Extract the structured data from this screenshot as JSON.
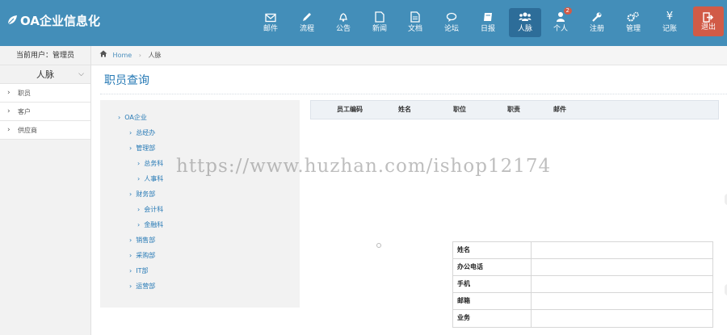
{
  "brand": {
    "title": "OA企业信息化"
  },
  "nav": [
    {
      "label": "邮件",
      "icon": "mail-icon"
    },
    {
      "label": "流程",
      "icon": "pencil-icon"
    },
    {
      "label": "公告",
      "icon": "bell-icon"
    },
    {
      "label": "新闻",
      "icon": "document-icon"
    },
    {
      "label": "文档",
      "icon": "file-icon"
    },
    {
      "label": "论坛",
      "icon": "chat-icon"
    },
    {
      "label": "日报",
      "icon": "book-icon"
    },
    {
      "label": "人脉",
      "icon": "group-icon",
      "active": true
    },
    {
      "label": "个人",
      "icon": "user-icon",
      "badge": "2"
    },
    {
      "label": "注册",
      "icon": "wrench-icon"
    },
    {
      "label": "管理",
      "icon": "cogs-icon"
    },
    {
      "label": "记账",
      "icon": "yen-icon"
    },
    {
      "label": "退出",
      "icon": "logout-icon"
    }
  ],
  "sidebar": {
    "current_user": "当前用户：管理员",
    "section_title": "人脉",
    "items": [
      {
        "label": "职员"
      },
      {
        "label": "客户"
      },
      {
        "label": "供应商"
      }
    ]
  },
  "breadcrumb": {
    "home": "Home",
    "current": "人脉"
  },
  "page_title": "职员查询",
  "tree": [
    {
      "label": "OA企业",
      "level": 0
    },
    {
      "label": "总经办",
      "level": 1
    },
    {
      "label": "管理部",
      "level": 1
    },
    {
      "label": "总务科",
      "level": 2
    },
    {
      "label": "人事科",
      "level": 2
    },
    {
      "label": "财务部",
      "level": 1
    },
    {
      "label": "会计科",
      "level": 2
    },
    {
      "label": "金融科",
      "level": 2
    },
    {
      "label": "销售部",
      "level": 1
    },
    {
      "label": "采购部",
      "level": 1
    },
    {
      "label": "IT部",
      "level": 1
    },
    {
      "label": "运营部",
      "level": 1
    }
  ],
  "employee_table": {
    "columns": [
      "员工编码",
      "姓名",
      "职位",
      "职责",
      "邮件"
    ]
  },
  "detail_table": {
    "rows": [
      "姓名",
      "办公电话",
      "手机",
      "邮箱",
      "业务"
    ]
  },
  "watermark": "https://www.huzhan.com/ishop12174",
  "colors": {
    "topbar": "#438eb9",
    "active_nav": "#2d6d99",
    "exit_button": "#d15b47",
    "link": "#2679b5"
  }
}
